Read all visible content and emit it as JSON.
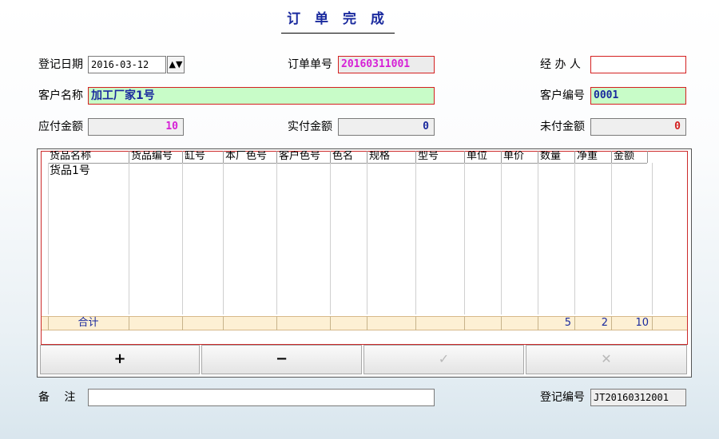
{
  "title": "订 单 完 成",
  "form": {
    "reg_date_label": "登记日期",
    "reg_date_value": "2016-03-12",
    "order_no_label": "订单单号",
    "order_no_value": "20160311001",
    "handler_label": "经 办 人",
    "handler_value": "",
    "customer_name_label": "客户名称",
    "customer_name_value": "加工厂家1号",
    "customer_no_label": "客户编号",
    "customer_no_value": "0001",
    "payable_label": "应付金额",
    "payable_value": "10",
    "paid_label": "实付金额",
    "paid_value": "0",
    "unpaid_label": "未付金额",
    "unpaid_value": "0",
    "remark_label": "备　 注",
    "remark_value": "",
    "reg_no_label": "登记编号",
    "reg_no_value": "JT20160312001"
  },
  "colors": {
    "pink_text": "#d61fd6",
    "blue_text": "#1a2a9e",
    "red_text": "#d42020",
    "green_bg": "#c8fcc8"
  },
  "table": {
    "columns": [
      "货品名称",
      "货品编号",
      "缸号",
      "本厂色号",
      "客户色号",
      "色名",
      "规格",
      "型号",
      "单位",
      "单价",
      "数量",
      "净重",
      "金额"
    ],
    "rows": [
      [
        "货品1号",
        "",
        "",
        "",
        "",
        "",
        "",
        "",
        "",
        "",
        "",
        "",
        ""
      ]
    ],
    "total_label": "合计",
    "totals": {
      "qty": "5",
      "weight": "2",
      "amount": "10"
    }
  },
  "buttons": {
    "add": "+",
    "remove": "−",
    "confirm": "✓",
    "cancel": "✕"
  },
  "spinner_icon": "spinner-arrows-icon"
}
